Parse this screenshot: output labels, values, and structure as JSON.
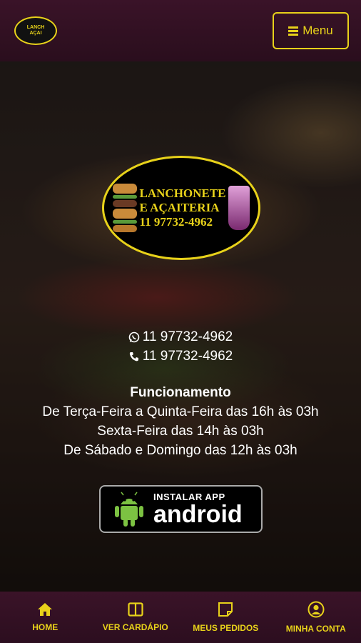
{
  "header": {
    "logo_alt": "Lanchonete e Açaiteria",
    "menu_label": "Menu"
  },
  "logo": {
    "line1": "LANCHONETE",
    "line2": "E AÇAITERIA",
    "line3": "11 97732-4962"
  },
  "contact": {
    "whatsapp": "11 97732-4962",
    "phone": "11 97732-4962"
  },
  "hours": {
    "title": "Funcionamento",
    "lines": [
      "De Terça-Feira a Quinta-Feira das 16h às 03h",
      "Sexta-Feira das 14h às 03h",
      "De Sábado e Domingo das 12h às 03h"
    ]
  },
  "app_badge": {
    "small": "INSTALAR APP",
    "big": "android"
  },
  "bottom_nav": [
    {
      "label": "HOME",
      "icon": "home-icon"
    },
    {
      "label": "VER CARDÁPIO",
      "icon": "book-icon"
    },
    {
      "label": "MEUS PEDIDOS",
      "icon": "orders-icon"
    },
    {
      "label": "MINHA CONTA",
      "icon": "user-icon"
    }
  ],
  "colors": {
    "accent": "#e8d21a",
    "bar": "#3a1328"
  }
}
